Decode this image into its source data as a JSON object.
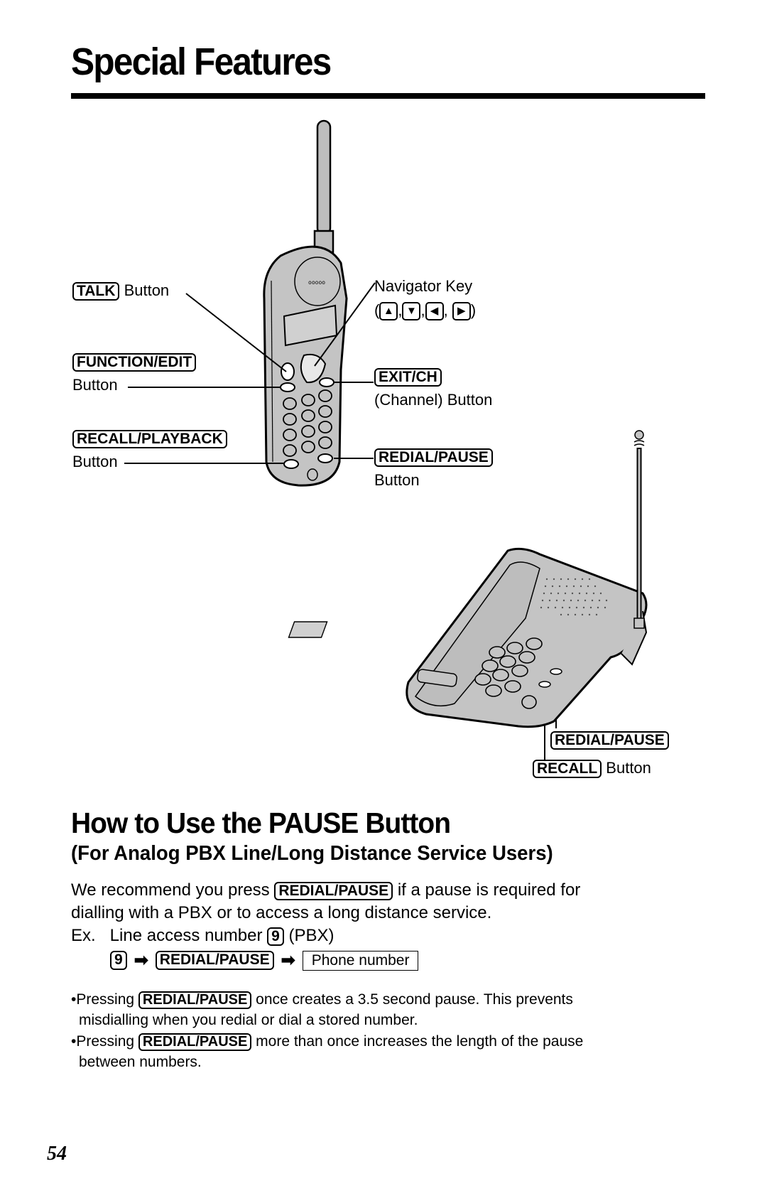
{
  "page": {
    "title": "Special Features",
    "page_number": "54"
  },
  "diagram": {
    "handset_labels": {
      "talk": {
        "key": "TALK",
        "suffix": "Button"
      },
      "function_edit": {
        "key": "FUNCTION/EDIT",
        "suffix": "Button"
      },
      "recall_playback": {
        "key": "RECALL/PLAYBACK",
        "suffix": "Button"
      },
      "navigator": {
        "text": "Navigator Key",
        "open": "(",
        "close": ")",
        "sep": ",",
        "keys": [
          "▲",
          "▼",
          "◀",
          "▶"
        ]
      },
      "exit_ch": {
        "key": "EXIT/CH",
        "suffix": "(Channel) Button"
      },
      "redial_pause": {
        "key": "REDIAL/PAUSE",
        "suffix": "Button"
      }
    },
    "base_labels": {
      "redial_pause": {
        "key": "REDIAL/PAUSE"
      },
      "recall": {
        "key": "RECALL",
        "suffix": "Button"
      }
    }
  },
  "section": {
    "heading": "How to Use the PAUSE Button",
    "subheading": "(For Analog PBX Line/Long Distance Service Users)",
    "intro": {
      "before": "We recommend you press",
      "key": "REDIAL/PAUSE",
      "after": "if a pause is required for",
      "line2": "dialling with a PBX or to access a long distance service."
    },
    "example": {
      "prefix": "Ex.   Line access number",
      "key": "9",
      "suffix": "(PBX)"
    },
    "sequence": {
      "step1": "9",
      "arrow": "➡",
      "step2": "REDIAL/PAUSE",
      "step3": "Phone number"
    },
    "bullets": [
      {
        "before": "•Pressing",
        "key": "REDIAL/PAUSE",
        "after": "once creates a 3.5 second pause. This prevents",
        "line2": "misdialling when you redial or dial a stored number."
      },
      {
        "before": "•Pressing",
        "key": "REDIAL/PAUSE",
        "after": "more than once increases the length of the pause",
        "line2": "between numbers."
      }
    ]
  }
}
